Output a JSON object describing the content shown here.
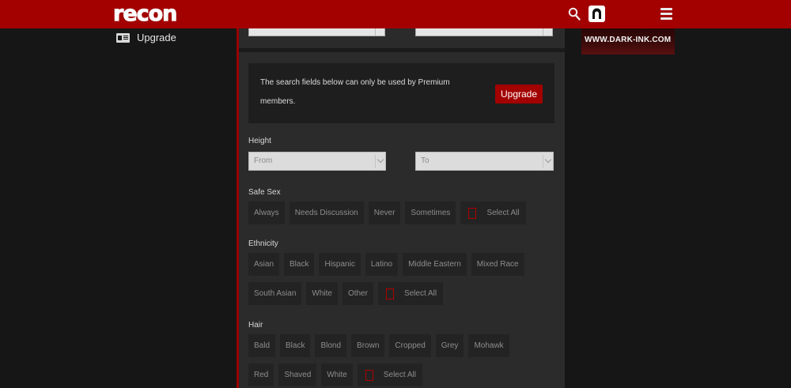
{
  "header": {
    "logo_text": "recon",
    "search_icon": "search-icon",
    "profile_icon": "profile-icon",
    "menu_icon": "hamburger-menu-icon",
    "brand_color": "#a30000"
  },
  "sidebar": {
    "upgrade_label": "Upgrade",
    "upgrade_icon": "id-card-icon"
  },
  "notice": {
    "text": "The search fields below can only be used by Premium members.",
    "button_label": "Upgrade"
  },
  "height": {
    "label": "Height",
    "from_value": "From",
    "to_value": "To"
  },
  "safe_sex": {
    "label": "Safe Sex",
    "options": [
      "Always",
      "Needs Discussion",
      "Never",
      "Sometimes"
    ],
    "select_all": "Select All"
  },
  "ethnicity": {
    "label": "Ethnicity",
    "options_row1": [
      "Asian",
      "Black",
      "Hispanic",
      "Latino",
      "Middle Eastern",
      "Mixed Race"
    ],
    "options_row2": [
      "South Asian",
      "White",
      "Other"
    ],
    "select_all": "Select All"
  },
  "hair": {
    "label": "Hair",
    "options_row1": [
      "Bald",
      "Black",
      "Blond",
      "Brown",
      "Cropped",
      "Grey",
      "Mohawk"
    ],
    "options_row2": [
      "Red",
      "Shaved",
      "White"
    ],
    "select_all": "Select All"
  },
  "ad": {
    "text": "WWW.DARK-INK.COM"
  }
}
